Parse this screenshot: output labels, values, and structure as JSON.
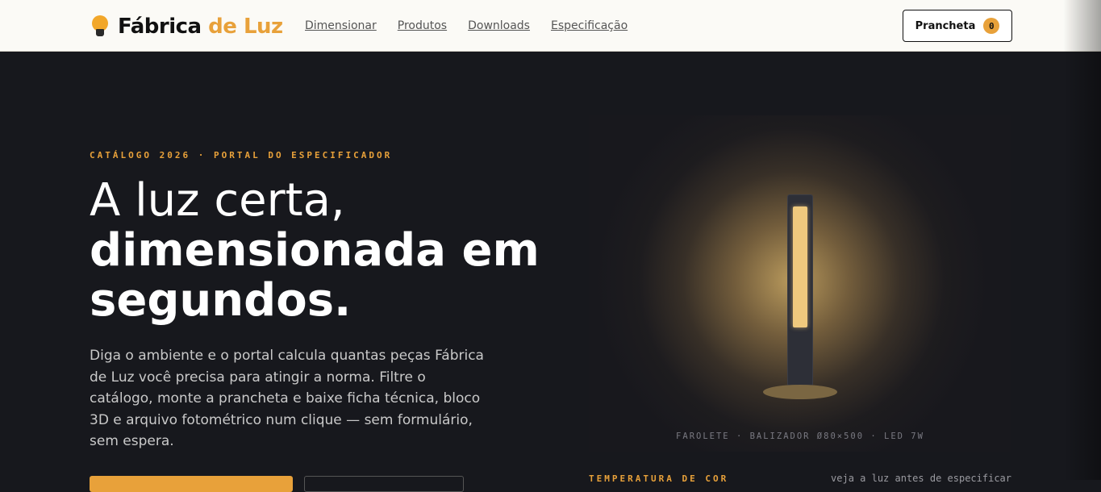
{
  "header": {
    "brand_main": "Fábrica",
    "brand_accent": "de Luz",
    "nav": [
      {
        "label": "Dimensionar"
      },
      {
        "label": "Produtos"
      },
      {
        "label": "Downloads"
      },
      {
        "label": "Especificação"
      }
    ],
    "prancheta": {
      "label": "Prancheta",
      "count": "0"
    }
  },
  "hero": {
    "eyebrow": "CATÁLOGO 2026 · PORTAL DO ESPECIFICADOR",
    "title_line1": "A luz certa,",
    "title_line2": "dimensionada em",
    "title_line3": "segundos.",
    "lead": "Diga o ambiente e o portal calcula quantas peças Fábrica de Luz você precisa para atingir a norma. Filtre o catálogo, monte a prancheta e baixe ficha técnica, bloco 3D e arquivo fotométrico num clique — sem formulário, sem espera."
  },
  "product": {
    "caption": "FAROLETE · BALIZADOR Ø80×500 · LED 7W",
    "temperature_label": "TEMPERATURA DE COR",
    "temperature_note": "veja a luz antes de especificar"
  },
  "colors": {
    "accent": "#e8a13a",
    "background": "#17181d",
    "topbar": "#fbfaf6"
  },
  "icons": {
    "logo": "lightbulb-icon"
  }
}
